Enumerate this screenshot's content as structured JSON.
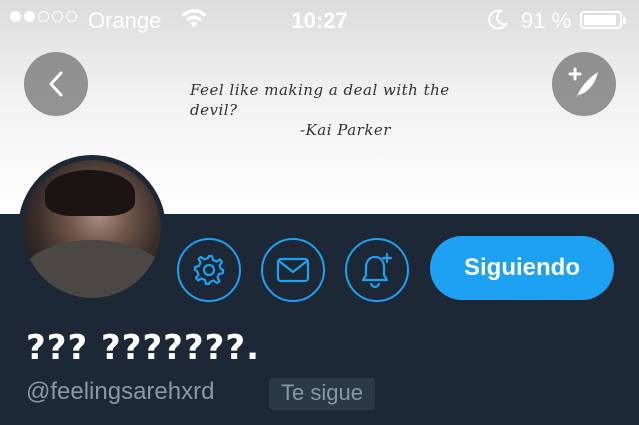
{
  "status_bar": {
    "carrier": "Orange",
    "time": "10:27",
    "battery_percent": "91 %",
    "signal_bars_filled": 2,
    "signal_bars_total": 5,
    "battery_level": 0.91
  },
  "header": {
    "quote_line1": "Feel like making a deal with the",
    "quote_line2": "devil?",
    "quote_signature": "-Kai Parker"
  },
  "profile": {
    "display_name": "??? ???????.",
    "handle": "@feelingsarehxrd",
    "follows_you_badge": "Te sigue",
    "follow_button_label": "Siguiendo"
  },
  "colors": {
    "accent": "#1da1f2",
    "background": "#1c2836",
    "secondary_text": "#8899a6"
  },
  "icons": [
    "back-icon",
    "compose-icon",
    "settings-icon",
    "mail-icon",
    "bell-plus-icon",
    "wifi-icon",
    "moon-icon",
    "battery-icon"
  ]
}
